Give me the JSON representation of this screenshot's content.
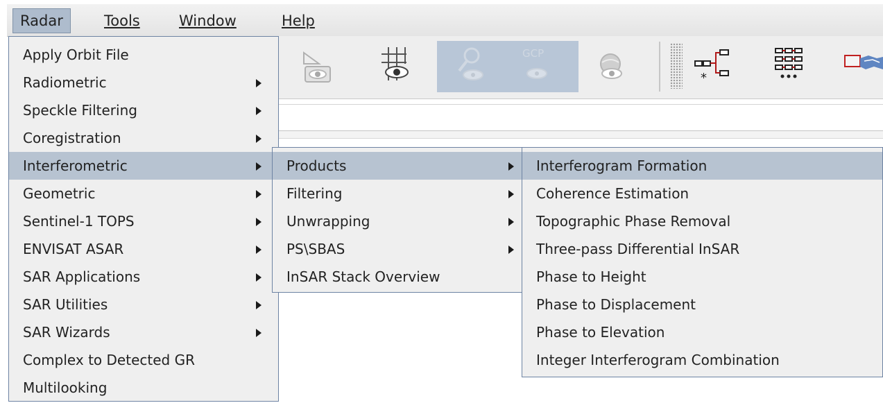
{
  "menubar": {
    "items": [
      {
        "label": "Radar",
        "active": true
      },
      {
        "label": "Tools",
        "mnemonic": "T"
      },
      {
        "label": "Window",
        "mnemonic": "W"
      },
      {
        "label": "Help",
        "mnemonic": "H"
      }
    ]
  },
  "toolbar": {
    "icons": [
      "eye-camera-icon",
      "graticule-eye-icon",
      "magnifier-eye-icon",
      "gcp-eye-icon",
      "globe-eye-icon",
      "graph-builder-icon",
      "batch-processing-icon",
      "world-map-icon"
    ],
    "gcp_text": "GCP",
    "highlight_color": "#b8c6d7"
  },
  "radar_menu": {
    "items": [
      {
        "label": "Apply Orbit File",
        "submenu": false
      },
      {
        "label": "Radiometric",
        "submenu": true
      },
      {
        "label": "Speckle Filtering",
        "submenu": true
      },
      {
        "label": "Coregistration",
        "submenu": true
      },
      {
        "label": "Interferometric",
        "submenu": true,
        "selected": true
      },
      {
        "label": "Geometric",
        "submenu": true
      },
      {
        "label": "Sentinel-1 TOPS",
        "submenu": true
      },
      {
        "label": "ENVISAT ASAR",
        "submenu": true
      },
      {
        "label": "SAR Applications",
        "submenu": true
      },
      {
        "label": "SAR Utilities",
        "submenu": true
      },
      {
        "label": "SAR Wizards",
        "submenu": true
      },
      {
        "label": "Complex to Detected GR",
        "submenu": false
      },
      {
        "label": "Multilooking",
        "submenu": false
      }
    ]
  },
  "interferometric_menu": {
    "items": [
      {
        "label": "Products",
        "submenu": true,
        "selected": true
      },
      {
        "label": "Filtering",
        "submenu": true
      },
      {
        "label": "Unwrapping",
        "submenu": true
      },
      {
        "label": "PS\\SBAS",
        "submenu": true
      },
      {
        "label": "InSAR Stack Overview",
        "submenu": false
      }
    ]
  },
  "products_menu": {
    "items": [
      {
        "label": "Interferogram Formation",
        "selected": true
      },
      {
        "label": "Coherence Estimation"
      },
      {
        "label": "Topographic Phase Removal"
      },
      {
        "label": "Three-pass Differential InSAR"
      },
      {
        "label": "Phase to Height"
      },
      {
        "label": "Phase to Displacement"
      },
      {
        "label": "Phase to Elevation"
      },
      {
        "label": "Integer Interferogram Combination"
      }
    ]
  },
  "colors": {
    "menu_bg": "#efefef",
    "menu_border": "#6d83a3",
    "selection": "#b7c3d1"
  }
}
